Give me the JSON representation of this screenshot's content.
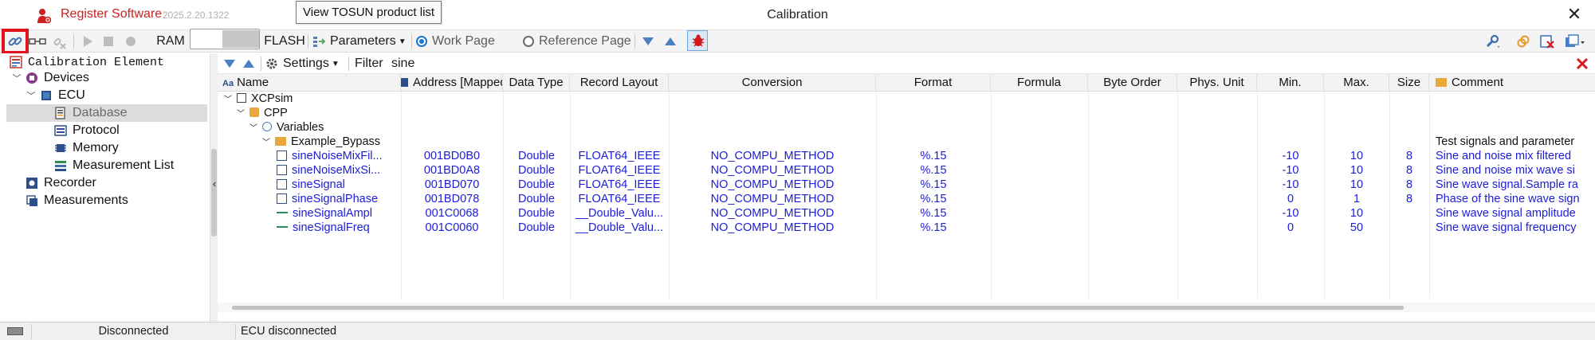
{
  "titlebar": {
    "register_label": "Register Software",
    "version": "2025.2.20.1322",
    "tooltip": "View TOSUN product list",
    "window_title": "Calibration",
    "close_glyph": "✕"
  },
  "toolbar": {
    "ram_label": "RAM",
    "flash_label": "FLASH",
    "parameters_label": "Parameters",
    "work_page_label": "Work Page",
    "reference_page_label": "Reference Page",
    "selected_page": "Work Page"
  },
  "tree": {
    "root_label": "Calibration Element",
    "items": [
      {
        "label": "Devices",
        "icon": "devices-icon"
      },
      {
        "label": "ECU",
        "icon": "ecu-icon"
      },
      {
        "label": "Database",
        "icon": "database-icon"
      },
      {
        "label": "Protocol",
        "icon": "protocol-icon"
      },
      {
        "label": "Memory",
        "icon": "memory-icon"
      },
      {
        "label": "Measurement List",
        "icon": "measurement-list-icon"
      },
      {
        "label": "Recorder",
        "icon": "recorder-icon"
      },
      {
        "label": "Measurements",
        "icon": "measurements-icon"
      }
    ],
    "selected": "Database"
  },
  "filterbar": {
    "settings_label": "Settings",
    "filter_label": "Filter",
    "filter_value": "sine"
  },
  "table": {
    "columns": [
      "Name",
      "Address [Mapped]",
      "Data Type",
      "Record Layout",
      "Conversion",
      "Format",
      "Formula",
      "Byte Order",
      "Phys. Unit",
      "Min.",
      "Max.",
      "Size",
      "Comment"
    ],
    "tree_nodes": [
      {
        "label": "XCPsim",
        "icon": "xcpsim-icon"
      },
      {
        "label": "CPP",
        "icon": "cpp-icon"
      },
      {
        "label": "Variables",
        "icon": "variables-icon"
      },
      {
        "label": "Example_Bypass",
        "icon": "folder-icon",
        "comment": "Test signals and parameter"
      }
    ],
    "rows": [
      {
        "name": "sineNoiseMixFil...",
        "icon": "measurement-icon",
        "address": "001BD0B0",
        "data_type": "Double",
        "record_layout": "FLOAT64_IEEE",
        "conversion": "NO_COMPU_METHOD",
        "format": "%.15",
        "formula": "",
        "byte_order": "",
        "phys_unit": "",
        "min": "-10",
        "max": "10",
        "size": "8",
        "comment": "Sine and noise mix filtered"
      },
      {
        "name": "sineNoiseMixSi...",
        "icon": "measurement-icon",
        "address": "001BD0A8",
        "data_type": "Double",
        "record_layout": "FLOAT64_IEEE",
        "conversion": "NO_COMPU_METHOD",
        "format": "%.15",
        "formula": "",
        "byte_order": "",
        "phys_unit": "",
        "min": "-10",
        "max": "10",
        "size": "8",
        "comment": "Sine and noise mix wave si"
      },
      {
        "name": "sineSignal",
        "icon": "measurement-icon",
        "address": "001BD070",
        "data_type": "Double",
        "record_layout": "FLOAT64_IEEE",
        "conversion": "NO_COMPU_METHOD",
        "format": "%.15",
        "formula": "",
        "byte_order": "",
        "phys_unit": "",
        "min": "-10",
        "max": "10",
        "size": "8",
        "comment": "Sine wave signal.Sample ra"
      },
      {
        "name": "sineSignalPhase",
        "icon": "measurement-icon",
        "address": "001BD078",
        "data_type": "Double",
        "record_layout": "FLOAT64_IEEE",
        "conversion": "NO_COMPU_METHOD",
        "format": "%.15",
        "formula": "",
        "byte_order": "",
        "phys_unit": "",
        "min": "0",
        "max": "1",
        "size": "8",
        "comment": "Phase of the sine wave sign"
      },
      {
        "name": "sineSignalAmpl",
        "icon": "parameter-icon",
        "address": "001C0068",
        "data_type": "Double",
        "record_layout": "__Double_Valu...",
        "conversion": "NO_COMPU_METHOD",
        "format": "%.15",
        "formula": "",
        "byte_order": "",
        "phys_unit": "",
        "min": "-10",
        "max": "10",
        "size": "",
        "comment": "Sine wave signal amplitude"
      },
      {
        "name": "sineSignalFreq",
        "icon": "parameter-icon",
        "address": "001C0060",
        "data_type": "Double",
        "record_layout": "__Double_Valu...",
        "conversion": "NO_COMPU_METHOD",
        "format": "%.15",
        "formula": "",
        "byte_order": "",
        "phys_unit": "",
        "min": "0",
        "max": "50",
        "size": "",
        "comment": "Sine wave signal frequency"
      }
    ]
  },
  "statusbar": {
    "connection": "Disconnected",
    "message": "ECU disconnected"
  },
  "colors": {
    "accent_red": "#e0141c",
    "value_blue": "#1c1cd8",
    "register_red": "#cc1f1f",
    "toolbar_blue": "#4a7fc1"
  }
}
